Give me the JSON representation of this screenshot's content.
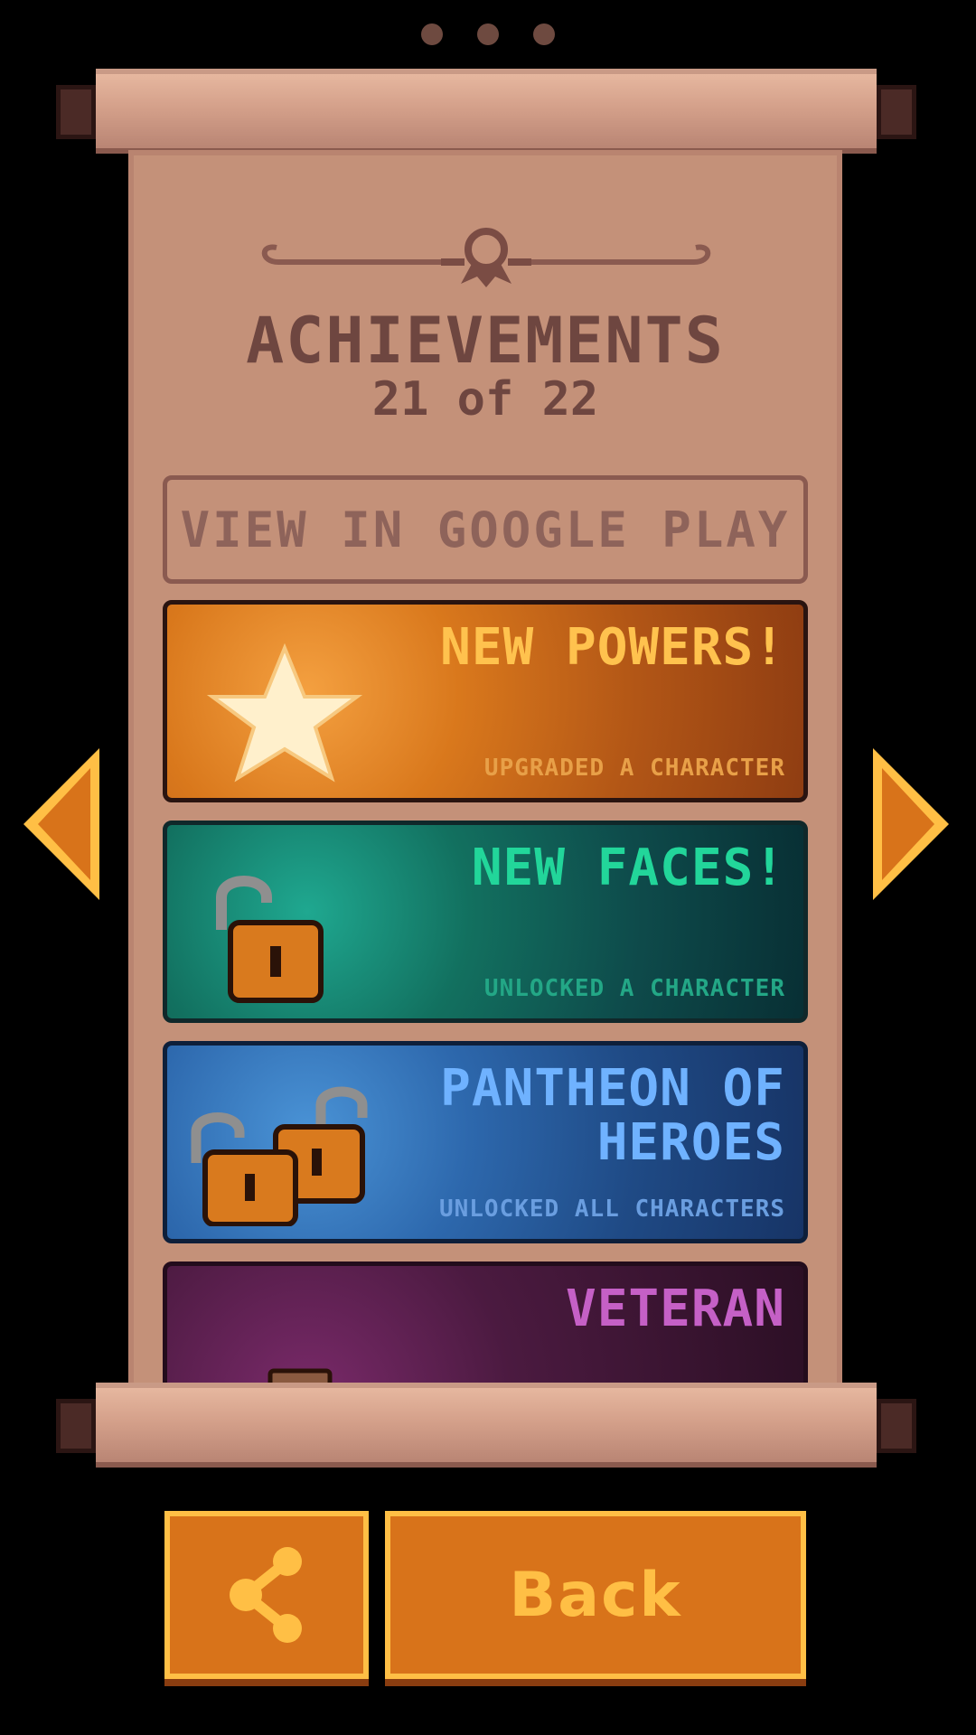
{
  "pager": {
    "dots": 3
  },
  "header": {
    "title": "ACHIEVEMENTS",
    "progress": "21 of 22"
  },
  "actions": {
    "google_play": "VIEW IN GOOGLE PLAY"
  },
  "achievements": [
    {
      "title": "NEW POWERS!",
      "description": "UPGRADED A CHARACTER",
      "icon": "star-icon"
    },
    {
      "title": "NEW FACES!",
      "description": "UNLOCKED A CHARACTER",
      "icon": "padlock-open-icon"
    },
    {
      "title": "PANTHEON OF HEROES",
      "description": "UNLOCKED ALL CHARACTERS",
      "icon": "two-padlocks-open-icon"
    },
    {
      "title": "VETERAN",
      "description": "",
      "icon": "potion-icon"
    }
  ],
  "footer": {
    "share_icon": "share-icon",
    "back_label": "Back"
  },
  "colors": {
    "parchment": "#c49179",
    "button": "#d8731a",
    "button_border": "#ffbf45"
  }
}
